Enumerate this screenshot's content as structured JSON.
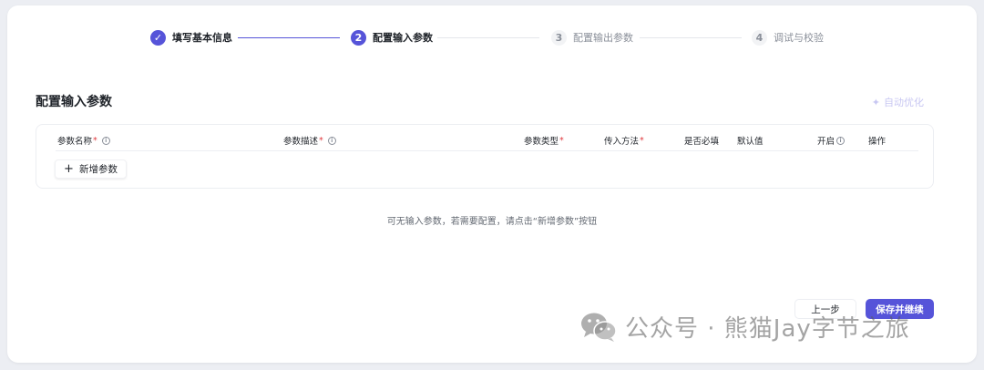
{
  "stepper": {
    "steps": [
      {
        "num": "✓",
        "label": "填写基本信息",
        "state": "done"
      },
      {
        "num": "2",
        "label": "配置输入参数",
        "state": "active"
      },
      {
        "num": "3",
        "label": "配置输出参数",
        "state": "todo"
      },
      {
        "num": "4",
        "label": "调试与校验",
        "state": "todo"
      }
    ]
  },
  "section": {
    "title": "配置输入参数",
    "auto_optimize": "自动优化"
  },
  "table": {
    "columns": [
      {
        "label": "参数名称",
        "required": "*",
        "info": "i"
      },
      {
        "label": "参数描述",
        "required": "*",
        "info": "i"
      },
      {
        "label": "参数类型",
        "required": "*"
      },
      {
        "label": "传入方法",
        "required": "*"
      },
      {
        "label": "是否必填"
      },
      {
        "label": "默认值"
      },
      {
        "label": "开启",
        "info": "i"
      },
      {
        "label": "操作"
      }
    ],
    "add_button": {
      "icon": "+",
      "label": "新增参数"
    }
  },
  "empty_hint": "可无输入参数，若需要配置，请点击“新增参数”按钮",
  "footer": {
    "prev_label": "上一步",
    "save_label": "保存并继续"
  },
  "watermark": {
    "text": "公众号 · 熊猫Jay字节之旅"
  },
  "colors": {
    "accent": "#5654d9",
    "required": "#e0393e",
    "muted_text": "#8a8f99"
  }
}
